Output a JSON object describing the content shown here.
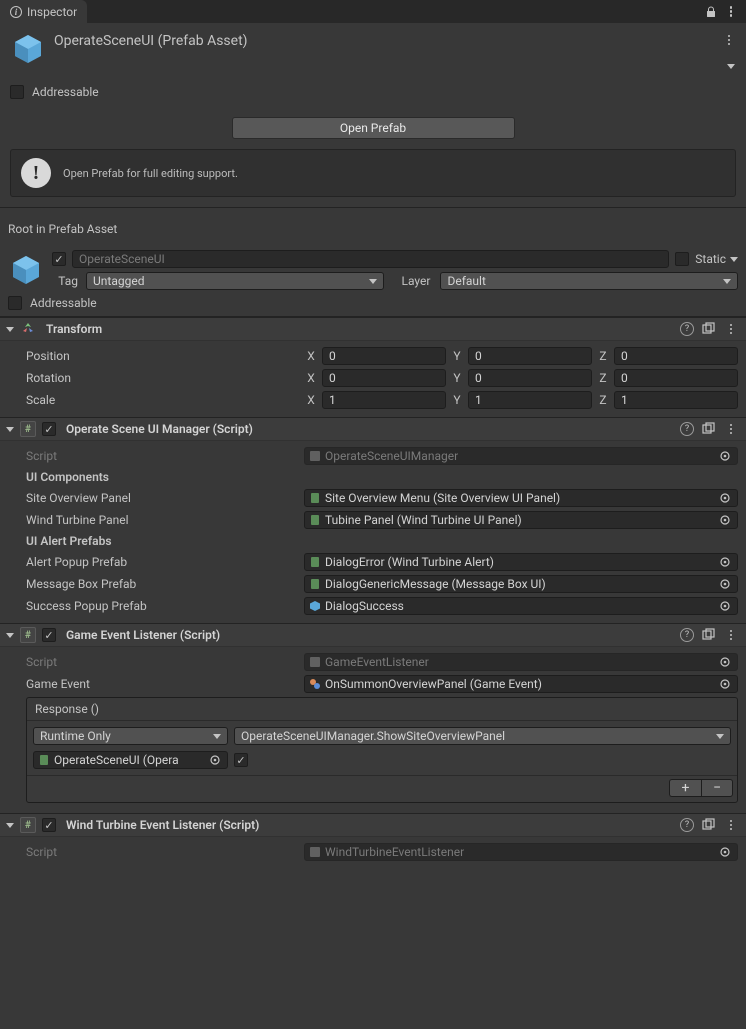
{
  "tab": {
    "title": "Inspector"
  },
  "asset": {
    "title": "OperateSceneUI (Prefab Asset)",
    "addressable_label": "Addressable",
    "open_button": "Open Prefab",
    "info_text": "Open Prefab for full editing support."
  },
  "root_label": "Root in Prefab Asset",
  "gameobject": {
    "name": "OperateSceneUI",
    "tag_label": "Tag",
    "tag_value": "Untagged",
    "layer_label": "Layer",
    "layer_value": "Default",
    "static_label": "Static",
    "addressable_label": "Addressable"
  },
  "transform": {
    "title": "Transform",
    "position_label": "Position",
    "rotation_label": "Rotation",
    "scale_label": "Scale",
    "pos": {
      "x": "0",
      "y": "0",
      "z": "0"
    },
    "rot": {
      "x": "0",
      "y": "0",
      "z": "0"
    },
    "scale": {
      "x": "1",
      "y": "1",
      "z": "1"
    }
  },
  "uimanager": {
    "title": "Operate Scene UI Manager (Script)",
    "script_label": "Script",
    "script_value": "OperateSceneUIManager",
    "header1": "UI Components",
    "site_overview_label": "Site Overview Panel",
    "site_overview_value": "Site Overview Menu (Site Overview UI Panel)",
    "wind_turbine_label": "Wind Turbine Panel",
    "wind_turbine_value": "Tubine Panel (Wind Turbine UI Panel)",
    "header2": "UI Alert Prefabs",
    "alert_popup_label": "Alert Popup Prefab",
    "alert_popup_value": "DialogError (Wind Turbine Alert)",
    "msgbox_label": "Message Box Prefab",
    "msgbox_value": "DialogGenericMessage (Message Box UI)",
    "success_label": "Success Popup Prefab",
    "success_value": "DialogSuccess"
  },
  "listener": {
    "title": "Game Event Listener (Script)",
    "script_label": "Script",
    "script_value": "GameEventListener",
    "game_event_label": "Game Event",
    "game_event_value": "OnSummonOverviewPanel (Game Event)",
    "response_label": "Response ()",
    "runtime_label": "Runtime Only",
    "function_value": "OperateSceneUIManager.ShowSiteOverviewPanel",
    "target_value": "OperateSceneUI (Opera"
  },
  "turbine_listener": {
    "title": "Wind Turbine Event Listener (Script)",
    "script_label": "Script",
    "script_value": "WindTurbineEventListener"
  }
}
